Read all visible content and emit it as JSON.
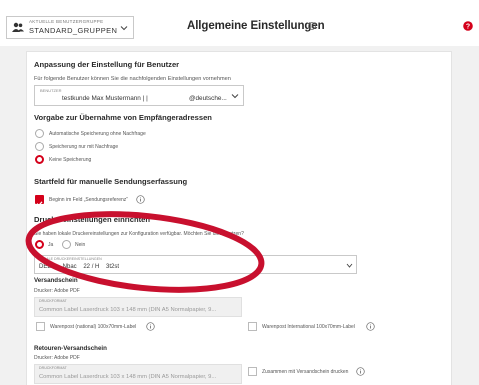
{
  "header": {
    "group_label": "AKTUELLE BENUTZERGRUPPE",
    "group_value": "STANDARD_GRUPPEN",
    "title": "Allgemeine Einstellungen"
  },
  "section_user": {
    "heading": "Anpassung der Einstellung für Benutzer",
    "description": "Für folgende Benutzer können Sie die nachfolgenden Einstellungen vornehmen",
    "select_label": "BENUTZER",
    "select_value_name": "testkunde  Max Mustermann | |",
    "select_value_mail": "@deutsche..."
  },
  "section_recipients": {
    "heading": "Vorgabe zur Übernahme von Empfängeradressen",
    "options": [
      "Automatische Speicherung ohne Nachfrage",
      "Speicherung nur mit Nachfrage",
      "Keine Speicherung"
    ],
    "selected_index": 2
  },
  "section_start": {
    "heading": "Startfeld für manuelle Sendungserfassung",
    "checkbox_label": "Beginn im Feld „Sendungsreferenz“",
    "checked": true
  },
  "section_printer": {
    "heading": "Druckereinstellungen einrichten",
    "question": "Sie haben lokale Druckereinstellungen zur Konfiguration verfügbar. Möchten Sie diese nutzen?",
    "yes_label": "Ja",
    "no_label": "Nein",
    "selected": "yes",
    "select_label": "LOKALE DRUCKEREINSTELLUNGEN",
    "select_value": "DEBO    Nbac    22 / H    3t2st"
  },
  "section_shipping": {
    "heading": "Versandschein",
    "printer_text": "Drucker: Adobe PDF",
    "format_label": "DRUCKFORMAT",
    "format_value": "Common Label Laserdruck 103 x 148 mm (DIN A5 Normalpapier, 9...",
    "option_national": "Warenpost (national) 100x70mm-Label",
    "option_international": "Warenpost International 100x70mm-Label"
  },
  "section_return": {
    "heading": "Retouren-Versandschein",
    "printer_text": "Drucker: Adobe PDF",
    "format_label": "DRUCKFORMAT",
    "format_value": "Common Label Laserdruck 103 x 148 mm (DIN A5 Normalpapier, 9...",
    "option_together": "Zusammen mit Versandschein drucken"
  },
  "colors": {
    "accent": "#d4001a",
    "annotation": "#c8102e"
  }
}
